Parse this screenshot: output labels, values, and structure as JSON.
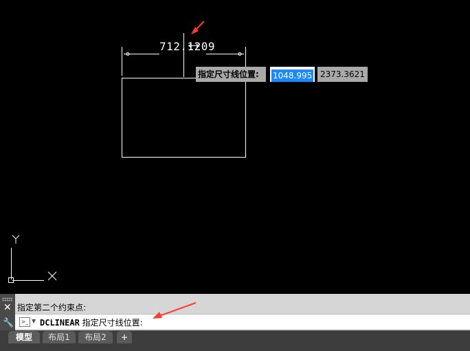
{
  "drawing": {
    "dimension_value": "712.1209",
    "tooltip": {
      "label": "指定尺寸线位置:",
      "value_x": "1048.995",
      "value_y": "2373.3621"
    },
    "ucs": {
      "x_label": "X",
      "y_label": "Y"
    }
  },
  "command": {
    "history_line": "指定第二个约束点:",
    "prompt_icon": ">_",
    "command_name": "DCLINEAR",
    "command_prompt": " 指定尺寸线位置:"
  },
  "tabs": [
    {
      "label": "模型",
      "active": true
    },
    {
      "label": "布局1",
      "active": false
    },
    {
      "label": "布局2",
      "active": false
    },
    {
      "label": "+",
      "active": false
    }
  ],
  "colors": {
    "background": "#000000",
    "highlight": "#1a88ff",
    "annotation_arrow": "#ff3b30"
  },
  "icons": [
    "close-icon",
    "wrench-icon",
    "command-prompt-icon",
    "chevron-down-icon",
    "ucs-icon"
  ]
}
